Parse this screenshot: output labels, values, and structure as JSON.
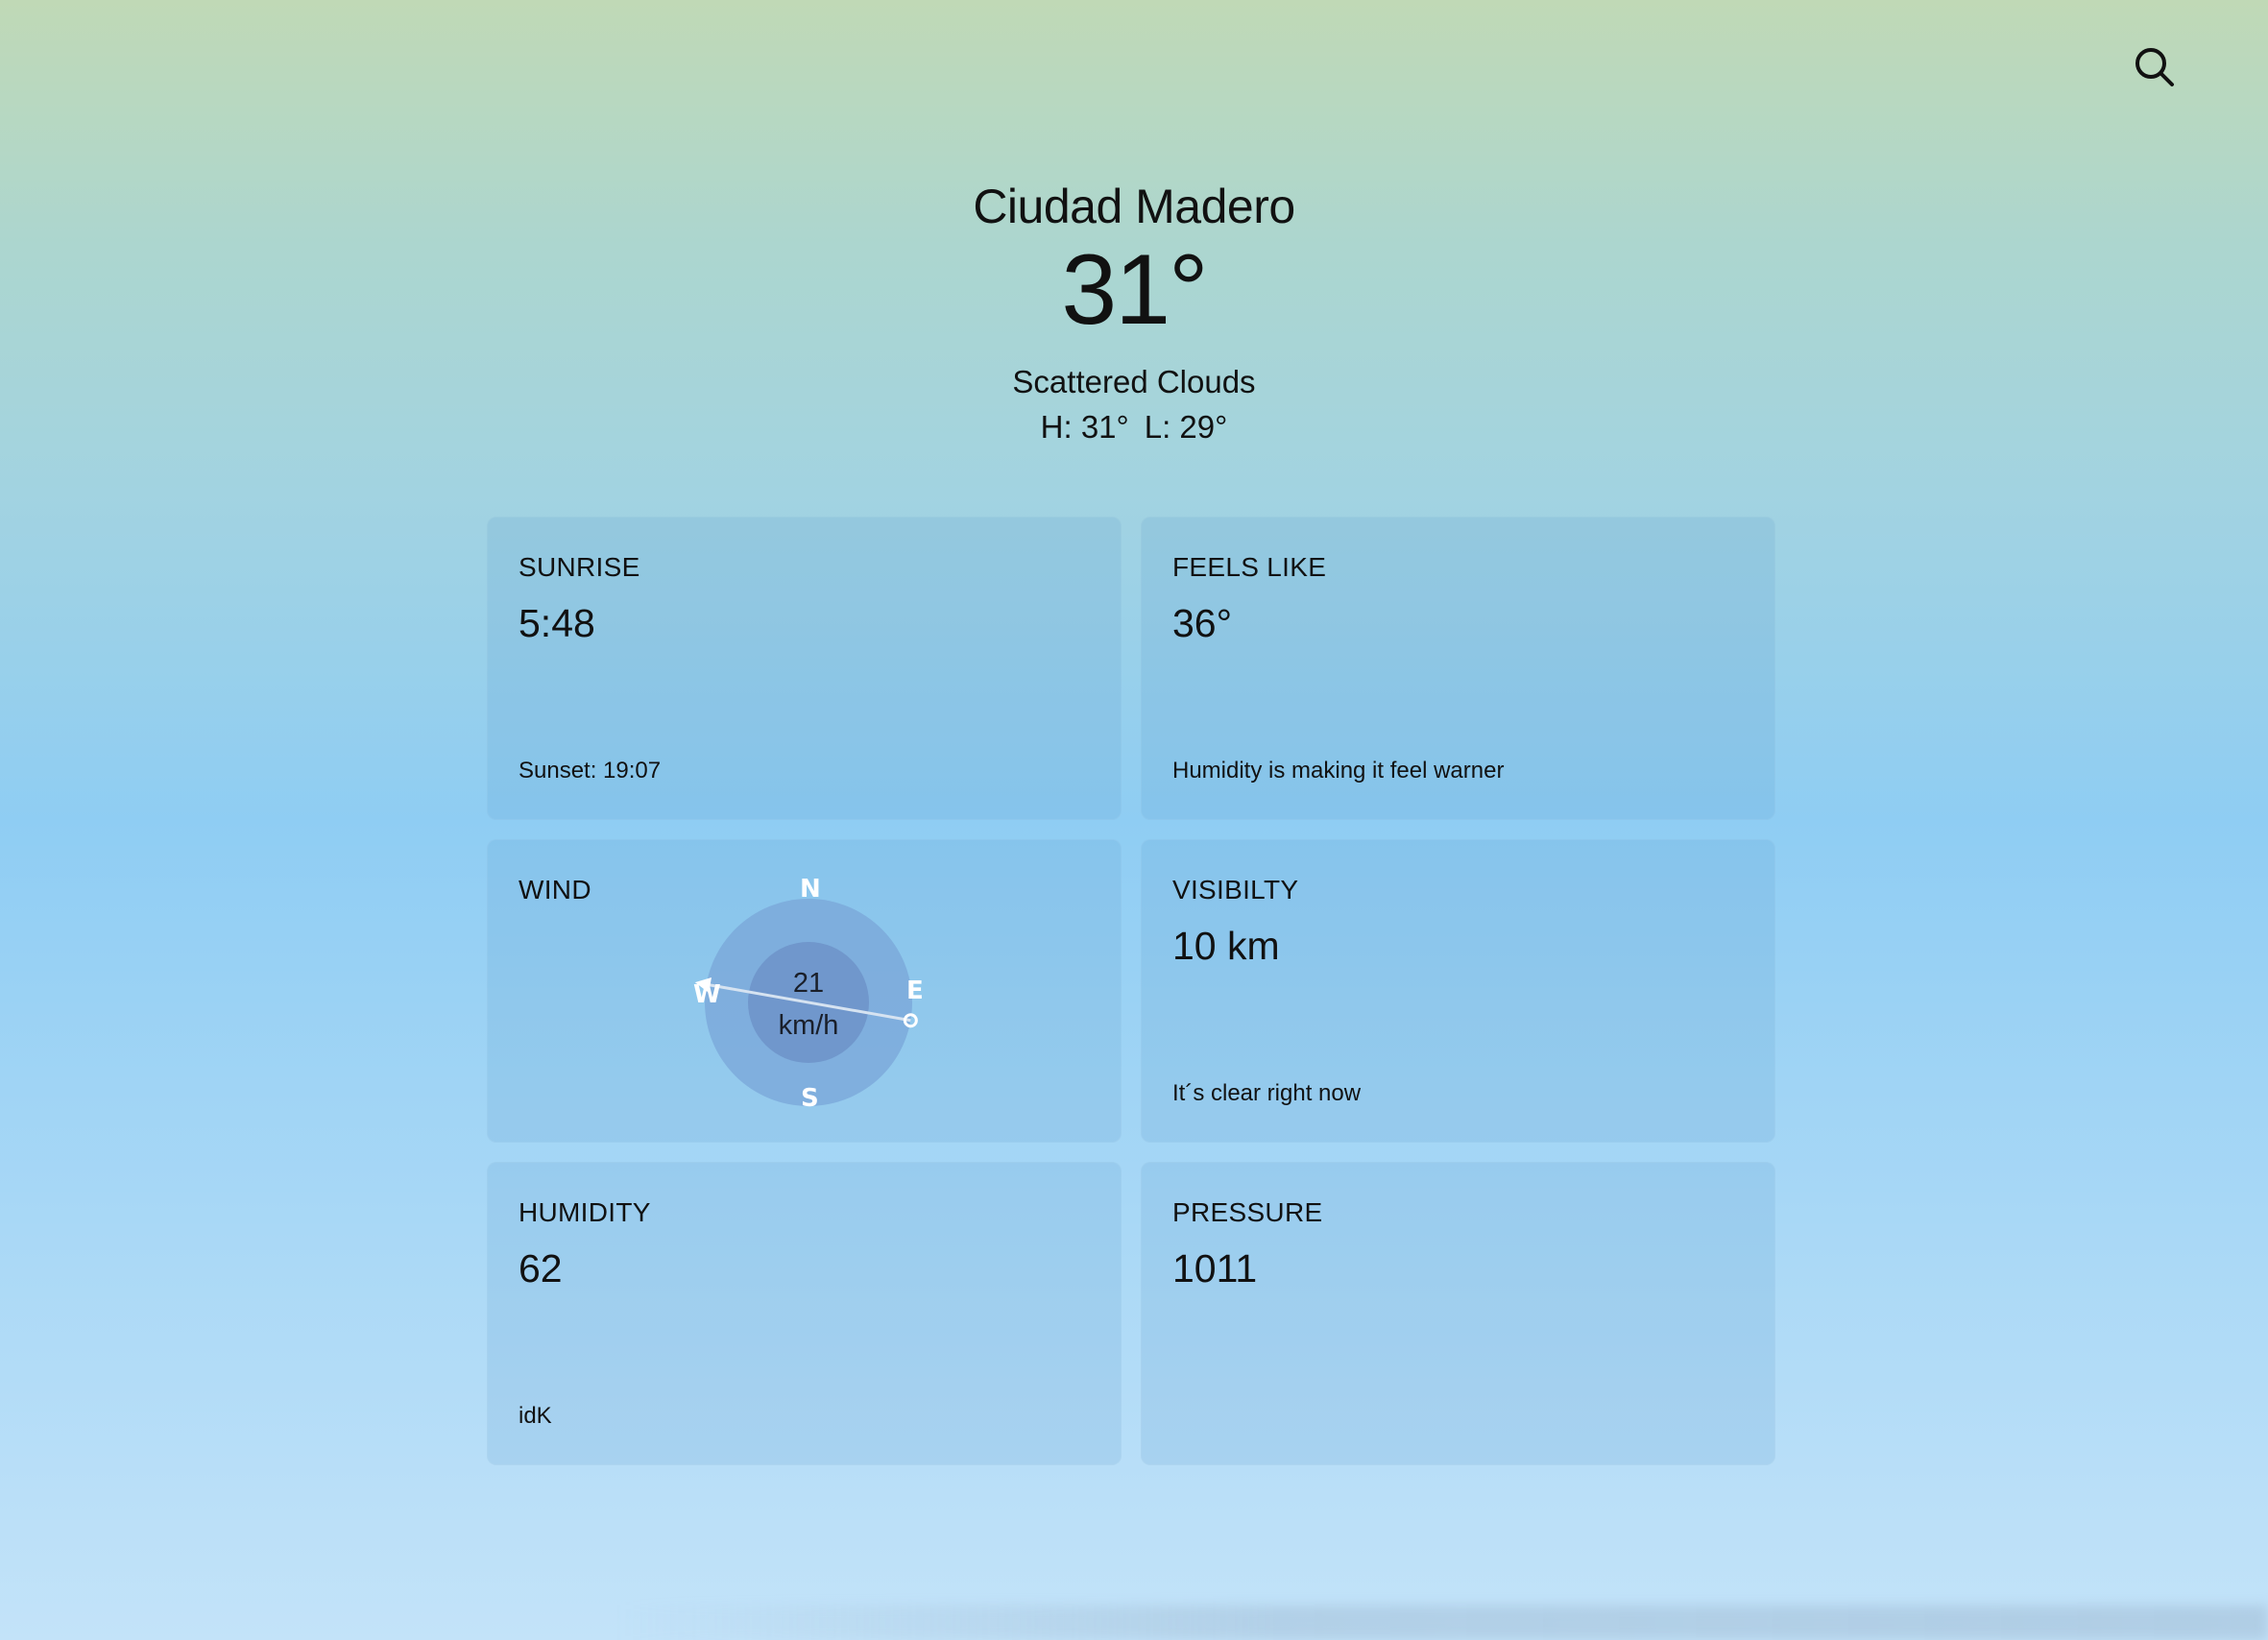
{
  "header": {
    "search_icon": "search-icon"
  },
  "current": {
    "city": "Ciudad Madero",
    "temperature": "31°",
    "condition": "Scattered Clouds",
    "high": "H: 31°",
    "low": "L: 29°"
  },
  "cards": {
    "sunrise": {
      "label": "SUNRISE",
      "value": "5:48",
      "note": "Sunset: 19:07"
    },
    "feels_like": {
      "label": "FEELS LIKE",
      "value": "36°",
      "note": "Humidity is making it feel warner"
    },
    "wind": {
      "label": "WIND",
      "speed_value": "21",
      "speed_unit": "km/h",
      "direction_degrees": 280,
      "compass": {
        "north": "N",
        "east": "E",
        "south": "S",
        "west": "W"
      }
    },
    "visibility": {
      "label": "VISIBILTY",
      "value": "10 km",
      "note": "It´s clear right now"
    },
    "humidity": {
      "label": "HUMIDITY",
      "value": "62",
      "note": "idK"
    },
    "pressure": {
      "label": "PRESSURE",
      "value": "1011"
    }
  },
  "colors": {
    "bg_top": "#c0d9b6",
    "bg_mid": "#8fcdf3",
    "bg_bottom": "#c3e3f9",
    "card_bg": "rgba(90,150,200,0.16)",
    "compass_outer": "#7aa6d8",
    "compass_inner": "#6d93c9"
  }
}
